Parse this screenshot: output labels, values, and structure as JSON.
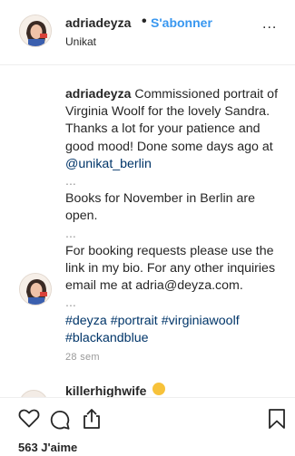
{
  "header": {
    "username": "adriadeyza",
    "separator": "•",
    "follow_label": "S'abonner",
    "location": "Unikat",
    "more_label": "..."
  },
  "caption": {
    "username": "adriadeyza",
    "text": " Commissioned portrait of Virginia Woolf for the lovely Sandra. Thanks a lot for your patience and good mood! Done some days ago at ",
    "mention": "@unikat_berlin",
    "gap1": "...",
    "line_november": "Books for November in Berlin are open.",
    "gap2": "...",
    "line_booking": "For booking requests please use the link in my bio. For any other inquiries email me at adria@deyza.com.",
    "gap3": "...",
    "hashtags": [
      "#deyza",
      "#portrait",
      "#virginiawoolf",
      "#blackandblue"
    ],
    "time": "28 sem"
  },
  "reply": {
    "username": "killerhighwife",
    "emoji_icon": "smiling-face-emoji"
  },
  "actions": {
    "likes": "563 J'aime",
    "icons": [
      "heart-icon",
      "comment-icon",
      "share-icon",
      "bookmark-icon"
    ]
  },
  "colors": {
    "link": "#003569",
    "follow": "#3897f0",
    "text": "#262626",
    "muted": "#999999",
    "border": "#efefef"
  }
}
